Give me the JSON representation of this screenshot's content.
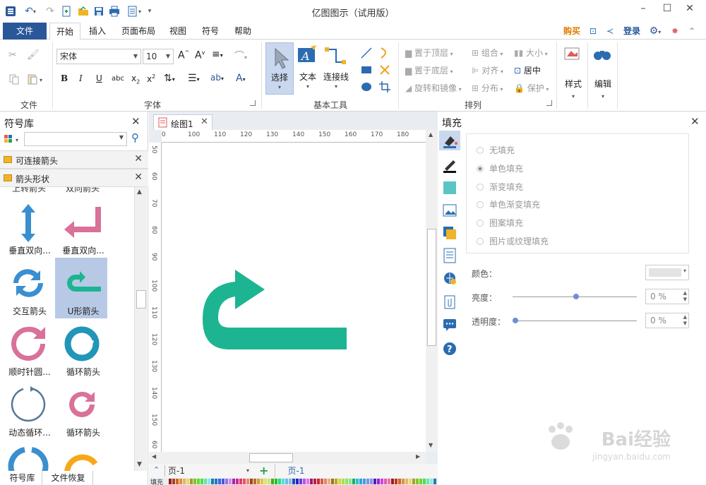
{
  "app": {
    "title": "亿图图示（试用版）",
    "buy": "购买",
    "login": "登录"
  },
  "menu": {
    "file": "文件",
    "home": "开始",
    "insert": "插入",
    "page_layout": "页面布局",
    "view": "视图",
    "symbol": "符号",
    "help": "帮助"
  },
  "ribbon": {
    "groups": {
      "file": "文件",
      "font": "字体",
      "basic_tools": "基本工具",
      "arrange": "排列"
    },
    "font_name": "宋体",
    "font_size": "10",
    "tools": {
      "select": "选择",
      "text": "文本",
      "connector": "连接线"
    },
    "arrange": {
      "bring_front": "置于顶层",
      "send_back": "置于底层",
      "rotate_mirror": "旋转和镜像",
      "group": "组合",
      "align": "对齐",
      "distribute": "分布",
      "size": "大小",
      "center": "居中",
      "protect": "保护"
    },
    "style": "样式",
    "edit": "编辑"
  },
  "library": {
    "title": "符号库",
    "categories": [
      {
        "label": "可连接箭头"
      },
      {
        "label": "箭头形状"
      }
    ],
    "top_partial": [
      "上转箭头",
      "双向箭头"
    ],
    "shapes": [
      {
        "name": "垂直双向..."
      },
      {
        "name": "垂直双向..."
      },
      {
        "name": "交互箭头"
      },
      {
        "name": "U形箭头"
      },
      {
        "name": "顺时针圆..."
      },
      {
        "name": "循环箭头"
      },
      {
        "name": "动态循环..."
      },
      {
        "name": "循环箭头"
      }
    ],
    "bottom_tabs": [
      "符号库",
      "文件恢复"
    ]
  },
  "document": {
    "tab": "绘图1",
    "hruler": [
      "0",
      "100",
      "110",
      "120",
      "130",
      "140",
      "150",
      "160",
      "170",
      "180"
    ],
    "vruler": [
      "50",
      "60",
      "70",
      "80",
      "90",
      "100",
      "110",
      "120",
      "130",
      "140",
      "150",
      "60"
    ],
    "page_combo": "页-1",
    "page_tab": "页-1",
    "fill_label": "填充"
  },
  "fill_panel": {
    "title": "填充",
    "options": [
      "无填充",
      "单色填充",
      "渐变填充",
      "单色渐变填充",
      "图案填充",
      "图片或纹理填充"
    ],
    "selected_option": "单色填充",
    "color_label": "颜色：",
    "brightness_label": "亮度：",
    "brightness_value": "0 %",
    "transparency_label": "透明度：",
    "transparency_value": "0 %"
  },
  "watermark": {
    "text": "Bai经验",
    "sub": "jingyan.baidu.com"
  },
  "colors": {
    "accent": "#2a579a",
    "shape_teal": "#1db591",
    "arrow_blue": "#3a8fd0",
    "arrow_pink": "#d9719a",
    "arrow_orange": "#f6a81b"
  }
}
